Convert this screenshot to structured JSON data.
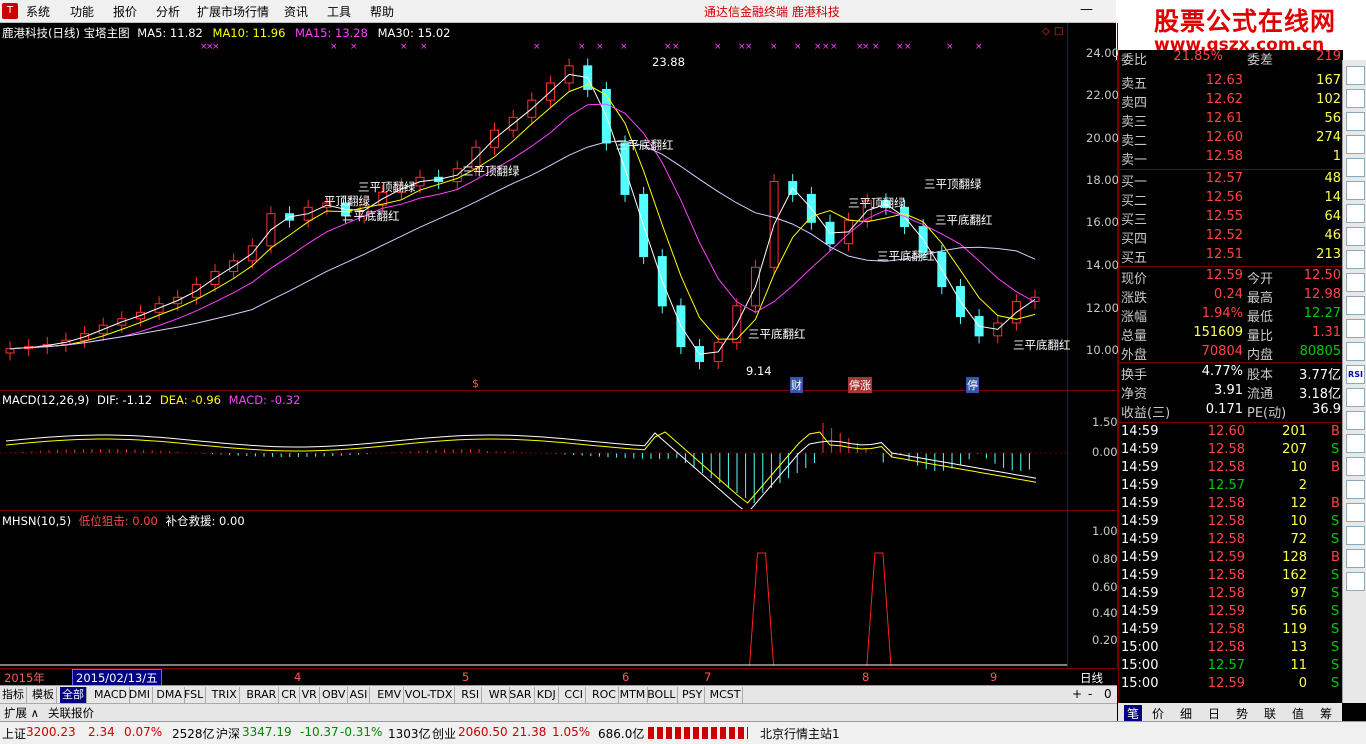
{
  "menu": {
    "items": [
      "系统",
      "功能",
      "报价",
      "分析",
      "扩展市场行情",
      "资讯",
      "工具",
      "帮助"
    ],
    "center_title": "通达信金融终端   鹿港科技"
  },
  "brand": {
    "line1": "股票公式在线网",
    "line2": "www.gszx.com.cn"
  },
  "main_panel": {
    "title": "鹿港科技(日线) 宝塔主图",
    "ma5": "MA5: 11.82",
    "ma10": "MA10: 11.96",
    "ma15": "MA15: 13.28",
    "ma30": "MA30: 15.02",
    "y_ticks": [
      "24.00",
      "22.00",
      "20.00",
      "18.00",
      "16.00",
      "14.00",
      "12.00",
      "10.00"
    ],
    "high_label": "23.88",
    "low_label": "9.14",
    "annotations": [
      {
        "text": "三平顶翻绿",
        "color": "#ffffff"
      },
      {
        "text": "平顶翻绿",
        "color": "#ffffff"
      },
      {
        "text": "三平顶翻绿",
        "color": "#ffffff"
      },
      {
        "text": "三平底翻红",
        "color": "#ffffff"
      },
      {
        "text": "三平底翻红",
        "color": "#ffffff"
      },
      {
        "text": "三平顶翻绿",
        "color": "#ffffff"
      },
      {
        "text": "三平底翻红",
        "color": "#ffffff"
      },
      {
        "text": "三平顶翻绿",
        "color": "#ffffff"
      },
      {
        "text": "三平顶翻绿",
        "color": "#ffffff"
      },
      {
        "text": "三平底翻红",
        "color": "#ffffff"
      },
      {
        "text": "三平底翻红",
        "color": "#ffffff"
      },
      {
        "text": "三平底翻红",
        "color": "#ffffff"
      },
      {
        "text": "三平底翻红",
        "color": "#ffffff"
      }
    ],
    "markers": [
      "$",
      "财",
      "停",
      "停"
    ],
    "marker_text_extra": "停涨"
  },
  "macd_panel": {
    "title": "MACD(12,26,9)",
    "dif": "DIF: -1.12",
    "dea": "DEA: -0.96",
    "macd": "MACD: -0.32",
    "y_ticks": [
      "1.50",
      "0.00",
      "-1.50"
    ]
  },
  "mhsn_panel": {
    "title": "MHSN(10,5)",
    "low_snipe": "低位狙击: 0.00",
    "rescue": "补仓救援: 0.00",
    "y_ticks": [
      "1.00",
      "0.80",
      "0.60",
      "0.40",
      "0.20"
    ]
  },
  "timebar": {
    "year": "2015年",
    "cursor_date": "2015/02/13/五",
    "months": [
      "4",
      "5",
      "6",
      "7",
      "8",
      "9"
    ],
    "period": "日线"
  },
  "tabs": {
    "left": [
      "指标",
      "模板",
      "全部"
    ],
    "indicators": [
      "MACD",
      "DMI",
      "DMA",
      "FSL",
      "TRIX",
      "BRAR",
      "CR",
      "VR",
      "OBV",
      "ASI",
      "EMV",
      "VOL-TDX",
      "RSI",
      "WR",
      "SAR",
      "KDJ",
      "CCI",
      "ROC",
      "MTM",
      "BOLL",
      "PSY",
      "MCST"
    ],
    "right_controls": [
      "+",
      "-",
      "0"
    ]
  },
  "subbar": {
    "items": [
      "扩展 ∧",
      "关联报价"
    ]
  },
  "quote": {
    "committee": {
      "label": "委比",
      "value": "21.85%",
      "label2": "委差",
      "value2": "219"
    },
    "sell": [
      {
        "label": "卖五",
        "price": "12.63",
        "vol": "167"
      },
      {
        "label": "卖四",
        "price": "12.62",
        "vol": "102"
      },
      {
        "label": "卖三",
        "price": "12.61",
        "vol": "56"
      },
      {
        "label": "卖二",
        "price": "12.60",
        "vol": "274"
      },
      {
        "label": "卖一",
        "price": "12.58",
        "vol": "1"
      }
    ],
    "buy": [
      {
        "label": "买一",
        "price": "12.57",
        "vol": "48"
      },
      {
        "label": "买二",
        "price": "12.56",
        "vol": "14"
      },
      {
        "label": "买三",
        "price": "12.55",
        "vol": "64"
      },
      {
        "label": "买四",
        "price": "12.52",
        "vol": "46"
      },
      {
        "label": "买五",
        "price": "12.51",
        "vol": "213"
      }
    ],
    "stats": [
      {
        "l1": "现价",
        "v1": "12.59",
        "c1": "#ff4444",
        "l2": "今开",
        "v2": "12.50",
        "c2": "#ff4444"
      },
      {
        "l1": "涨跌",
        "v1": "0.24",
        "c1": "#ff4444",
        "l2": "最高",
        "v2": "12.98",
        "c2": "#ff4444"
      },
      {
        "l1": "涨幅",
        "v1": "1.94%",
        "c1": "#ff4444",
        "l2": "最低",
        "v2": "12.27",
        "c2": "#00cc00"
      },
      {
        "l1": "总量",
        "v1": "151609",
        "c1": "#ffff55",
        "l2": "量比",
        "v2": "1.31",
        "c2": "#ff4444"
      },
      {
        "l1": "外盘",
        "v1": "70804",
        "c1": "#ff4444",
        "l2": "内盘",
        "v2": "80805",
        "c2": "#00cc00"
      }
    ],
    "stats2": [
      {
        "l1": "换手",
        "v1": "4.77%",
        "l2": "股本",
        "v2": "3.77亿"
      },
      {
        "l1": "净资",
        "v1": "3.91",
        "l2": "流通",
        "v2": "3.18亿"
      },
      {
        "l1": "收益(三)",
        "v1": "0.171",
        "l2": "PE(动)",
        "v2": "36.9"
      }
    ],
    "ticks": [
      {
        "t": "14:59",
        "p": "12.60",
        "v": "201",
        "s": "B"
      },
      {
        "t": "14:59",
        "p": "12.58",
        "v": "207",
        "s": "S"
      },
      {
        "t": "14:59",
        "p": "12.58",
        "v": "10",
        "s": "B"
      },
      {
        "t": "14:59",
        "p": "12.57",
        "v": "2",
        "s": ""
      },
      {
        "t": "14:59",
        "p": "12.58",
        "v": "12",
        "s": "B"
      },
      {
        "t": "14:59",
        "p": "12.58",
        "v": "10",
        "s": "S"
      },
      {
        "t": "14:59",
        "p": "12.58",
        "v": "72",
        "s": "S"
      },
      {
        "t": "14:59",
        "p": "12.59",
        "v": "128",
        "s": "B"
      },
      {
        "t": "14:59",
        "p": "12.58",
        "v": "162",
        "s": "S"
      },
      {
        "t": "14:59",
        "p": "12.58",
        "v": "97",
        "s": "S"
      },
      {
        "t": "14:59",
        "p": "12.59",
        "v": "56",
        "s": "S"
      },
      {
        "t": "14:59",
        "p": "12.58",
        "v": "119",
        "s": "S"
      },
      {
        "t": "15:00",
        "p": "12.58",
        "v": "13",
        "s": "S"
      },
      {
        "t": "15:00",
        "p": "12.57",
        "v": "11",
        "s": "S"
      },
      {
        "t": "15:00",
        "p": "12.59",
        "v": "0",
        "s": "S"
      }
    ],
    "bottom_tabs": [
      "笔",
      "价",
      "细",
      "日",
      "势",
      "联",
      "值",
      "筹"
    ]
  },
  "side_icons": [
    "RSI"
  ],
  "status": {
    "sh_label": "上证",
    "sh_value": "3200.23",
    "sh_chg": "2.34",
    "sh_pct": "0.07%",
    "sh_amt": "2528亿",
    "sz_label": "沪深",
    "sz_value": "3347.19",
    "sz_chg": "-10.37",
    "sz_pct": "-0.31%",
    "sz_amt": "1303亿",
    "cy_label": "创业",
    "cy_value": "2060.50",
    "cy_chg": "21.38",
    "cy_pct": "1.05%",
    "cy_amt": "686.0亿",
    "station": "北京行情主站1"
  },
  "colors": {
    "up": "#ff3030",
    "down": "#54ffff",
    "ma5": "#ffffff",
    "ma10": "#ffff00",
    "ma15": "#ff40ff",
    "ma30": "#00ff00",
    "dif": "#ffffff",
    "dea": "#ffff00",
    "grid": "#7a0000"
  },
  "chart_data": [
    {
      "type": "candlestick",
      "title": "鹿港科技(日线) 宝塔主图",
      "ylim": [
        9,
        25
      ],
      "x_ticks": [
        "4",
        "5",
        "6",
        "7",
        "8",
        "9"
      ],
      "close_series": [
        10.2,
        10.3,
        10.4,
        10.6,
        10.9,
        11.3,
        11.6,
        11.9,
        12.3,
        12.6,
        13.2,
        13.8,
        14.3,
        15.0,
        16.5,
        16.2,
        16.8,
        17.0,
        16.4,
        16.9,
        17.5,
        17.8,
        18.2,
        18.0,
        18.6,
        19.6,
        20.4,
        21.0,
        21.8,
        22.6,
        23.4,
        22.3,
        19.8,
        17.4,
        14.5,
        12.2,
        10.3,
        9.6,
        10.5,
        12.2,
        14.0,
        18.0,
        17.4,
        16.1,
        15.1,
        16.2,
        17.1,
        16.8,
        15.9,
        14.7,
        13.1,
        11.7,
        10.8,
        11.4,
        12.4,
        12.6
      ]
    },
    {
      "type": "bar",
      "title": "MACD(12,26,9)",
      "ylim": [
        -1.5,
        1.5
      ]
    },
    {
      "type": "line",
      "title": "MHSN(10,5)",
      "ylim": [
        0,
        1.0
      ],
      "series": [
        {
          "name": "低位狙击",
          "peaks_at": [
            0.62,
            0.73
          ]
        }
      ]
    }
  ]
}
